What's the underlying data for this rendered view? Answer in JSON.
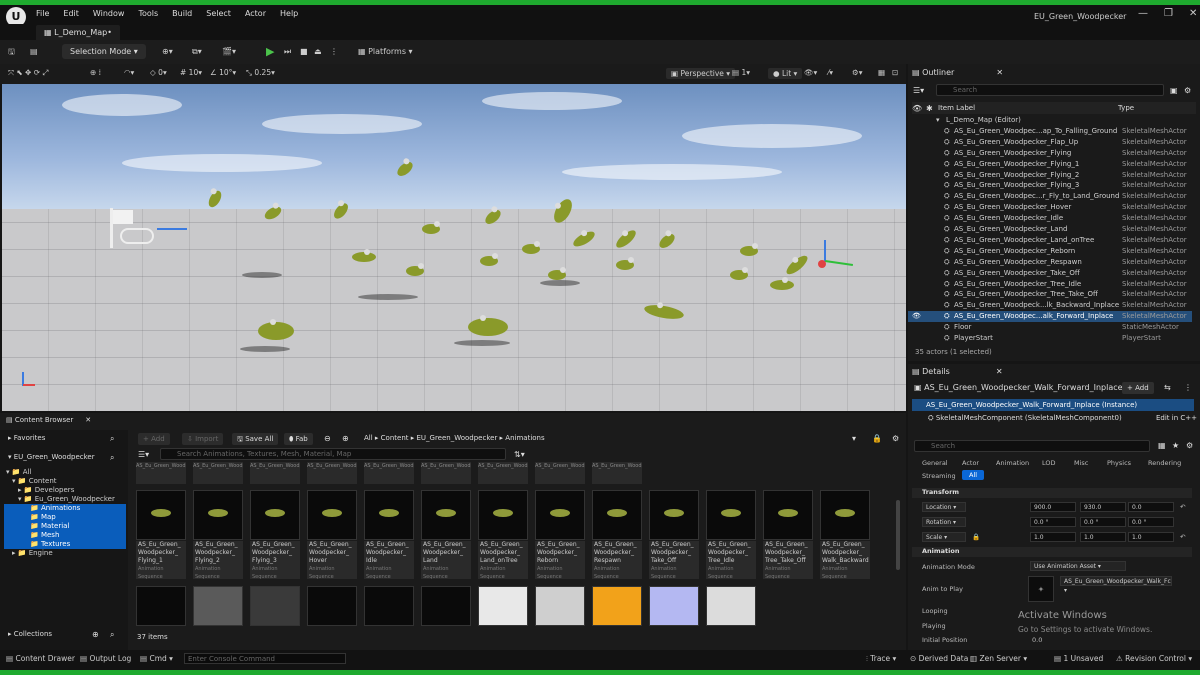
{
  "menu": [
    "File",
    "Edit",
    "Window",
    "Tools",
    "Build",
    "Select",
    "Actor",
    "Help"
  ],
  "window_title": "EU_Green_Woodpecker",
  "map_tab": "L_Demo_Map•",
  "toolbar": {
    "selection_mode": "Selection Mode",
    "platforms": "Platforms"
  },
  "viewport_toolbar": {
    "rot_snap": "0",
    "grid_snap": "10",
    "angle_snap": "10°",
    "scale_snap": "0.25",
    "perspective": "Perspective",
    "lit": "Lit",
    "camera_speed": "1"
  },
  "outliner": {
    "title": "Outliner",
    "search_placeholder": "Search",
    "col_label": "Item Label",
    "col_type": "Type",
    "items": [
      {
        "label": "L_Demo_Map (Editor)",
        "type": ""
      },
      {
        "label": "AS_Eu_Green_Woodpec...ap_To_Falling_Ground",
        "type": "SkeletalMeshActor"
      },
      {
        "label": "AS_Eu_Green_Woodpecker_Flap_Up",
        "type": "SkeletalMeshActor"
      },
      {
        "label": "AS_Eu_Green_Woodpecker_Flying",
        "type": "SkeletalMeshActor"
      },
      {
        "label": "AS_Eu_Green_Woodpecker_Flying_1",
        "type": "SkeletalMeshActor"
      },
      {
        "label": "AS_Eu_Green_Woodpecker_Flying_2",
        "type": "SkeletalMeshActor"
      },
      {
        "label": "AS_Eu_Green_Woodpecker_Flying_3",
        "type": "SkeletalMeshActor"
      },
      {
        "label": "AS_Eu_Green_Woodpec...r_Fly_to_Land_Ground",
        "type": "SkeletalMeshActor"
      },
      {
        "label": "AS_Eu_Green_Woodpecker_Hover",
        "type": "SkeletalMeshActor"
      },
      {
        "label": "AS_Eu_Green_Woodpecker_Idle",
        "type": "SkeletalMeshActor"
      },
      {
        "label": "AS_Eu_Green_Woodpecker_Land",
        "type": "SkeletalMeshActor"
      },
      {
        "label": "AS_Eu_Green_Woodpecker_Land_onTree",
        "type": "SkeletalMeshActor"
      },
      {
        "label": "AS_Eu_Green_Woodpecker_Reborn",
        "type": "SkeletalMeshActor"
      },
      {
        "label": "AS_Eu_Green_Woodpecker_Respawn",
        "type": "SkeletalMeshActor"
      },
      {
        "label": "AS_Eu_Green_Woodpecker_Take_Off",
        "type": "SkeletalMeshActor"
      },
      {
        "label": "AS_Eu_Green_Woodpecker_Tree_Idle",
        "type": "SkeletalMeshActor"
      },
      {
        "label": "AS_Eu_Green_Woodpecker_Tree_Take_Off",
        "type": "SkeletalMeshActor"
      },
      {
        "label": "AS_Eu_Green_Woodpeck...lk_Backward_Inplace",
        "type": "SkeletalMeshActor"
      },
      {
        "label": "AS_Eu_Green_Woodpec...alk_Forward_Inplace",
        "type": "SkeletalMeshActor"
      },
      {
        "label": "Floor",
        "type": "StaticMeshActor"
      },
      {
        "label": "PlayerStart",
        "type": "PlayerStart"
      }
    ],
    "count": "35 actors (1 selected)"
  },
  "details": {
    "title": "Details",
    "actor_name": "AS_Eu_Green_Woodpecker_Walk_Forward_Inplace",
    "add": "+ Add",
    "instance": "AS_Eu_Green_Woodpecker_Walk_Forward_Inplace (Instance)",
    "component": "SkeletalMeshComponent (SkeletalMeshComponent0)",
    "edit_cpp": "Edit in C++",
    "search_placeholder": "Search",
    "tabs": [
      "General",
      "Actor",
      "Animation",
      "LOD",
      "Misc",
      "Physics",
      "Rendering",
      "Streaming",
      "All"
    ],
    "transform": "Transform",
    "location": "Location",
    "rotation": "Rotation",
    "scale": "Scale",
    "loc": [
      "900.0",
      "930.0",
      "0.0"
    ],
    "rot": [
      "0.0 °",
      "0.0 °",
      "0.0 °"
    ],
    "scl": [
      "1.0",
      "1.0",
      "1.0"
    ],
    "animation": "Animation",
    "anim_mode_label": "Animation Mode",
    "anim_mode": "Use Animation Asset",
    "anim_to_play": "Anim to Play",
    "anim_asset": "AS_Eu_Green_Woodpecker_Walk_Fc",
    "looping": "Looping",
    "playing": "Playing",
    "initial_position": "Initial Position",
    "initial_value": "0.0"
  },
  "content_browser": {
    "title": "Content Browser",
    "add": "Add",
    "import": "Import",
    "save_all": "Save All",
    "fab": "Fab",
    "path": [
      "All",
      "Content",
      "EU_Green_Woodpecker",
      "Animations"
    ],
    "favorites": "Favorites",
    "project": "EU_Green_Woodpecker",
    "search_placeholder": "Search Animations, Textures, Mesh, Material, Map",
    "tree": [
      "All",
      "Content",
      "Developers",
      "Eu_Green_Woodpecker",
      "Animations",
      "Map",
      "Material",
      "Mesh",
      "Textures",
      "Engine"
    ],
    "collections": "Collections",
    "items_count": "37 items",
    "top_labels": [
      "AS_Eu_Green_Woodpecker_Anim_Preview",
      "AS_Eu_Green_Woodpecker_Anim_Preview",
      "AS_Eu_Green_Woodpecker_Die_Mid_Shot",
      "AS_Eu_Green_Woodpecker_Falling_to",
      "AS_Eu_Green_Woodpecker_Flap_Forward",
      "AS_Eu_Green_Woodpecker_Flap_To_Falling",
      "AS_Eu_Green_Woodpecker_Flap_Up",
      "AS_Eu_Green_Woodpecker_to_Land",
      "AS_Eu_Green_Woodpecker_Flying"
    ],
    "assets": [
      [
        "AS_Eu_Green_",
        "Woodpecker_",
        "Flying_1"
      ],
      [
        "AS_Eu_Green_",
        "Woodpecker_",
        "Flying_2"
      ],
      [
        "AS_Eu_Green_",
        "Woodpecker_",
        "Flying_3"
      ],
      [
        "AS_Eu_Green_",
        "Woodpecker_",
        "Hover"
      ],
      [
        "AS_Eu_Green_",
        "Woodpecker_",
        "Idle"
      ],
      [
        "AS_Eu_Green_",
        "Woodpecker_",
        "Land"
      ],
      [
        "AS_Eu_Green_",
        "Woodpecker_",
        "Land_onTree"
      ],
      [
        "AS_Eu_Green_",
        "Woodpecker_",
        "Reborn"
      ],
      [
        "AS_Eu_Green_",
        "Woodpecker_",
        "Respawn"
      ],
      [
        "AS_Eu_Green_",
        "Woodpecker_",
        "Take_Off"
      ],
      [
        "AS_Eu_Green_",
        "Woodpecker_",
        "Tree_Idle"
      ],
      [
        "AS_Eu_Green_",
        "Woodpecker_",
        "Tree_Take_Off"
      ],
      [
        "AS_Eu_Green_",
        "Woodpecker_",
        "Walk_Backward"
      ]
    ],
    "asset_type": "Animation Sequence"
  },
  "status": {
    "content_drawer": "Content Drawer",
    "output_log": "Output Log",
    "cmd": "Cmd",
    "console_placeholder": "Enter Console Command",
    "trace": "Trace",
    "derived_data": "Derived Data",
    "zen": "Zen Server",
    "unsaved": "1 Unsaved",
    "revision": "Revision Control"
  },
  "watermark": {
    "title": "Activate Windows",
    "sub": "Go to Settings to activate Windows."
  }
}
